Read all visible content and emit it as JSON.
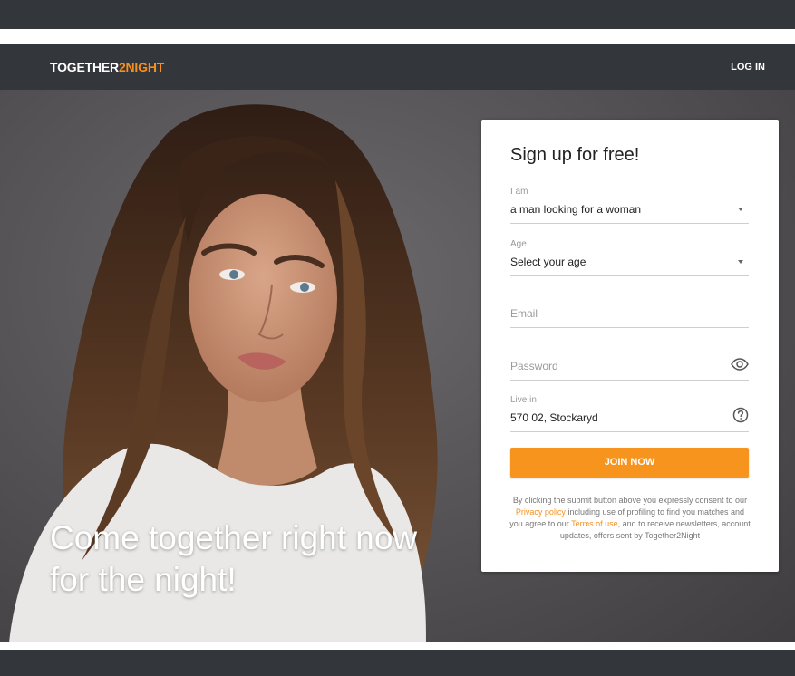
{
  "header": {
    "logo_part1": "TOGETHER",
    "logo_part2": "2NIGHT",
    "login_label": "LOG IN"
  },
  "hero": {
    "headline_line1": "Come together right now",
    "headline_line2": "for the night!"
  },
  "form": {
    "title": "Sign up for free!",
    "iam": {
      "label": "I am",
      "value": "a man looking for a woman"
    },
    "age": {
      "label": "Age",
      "value": "Select your age"
    },
    "email": {
      "placeholder": "Email"
    },
    "password": {
      "placeholder": "Password"
    },
    "location": {
      "label": "Live in",
      "value": "570 02, Stockaryd"
    },
    "submit_label": "JOIN NOW",
    "legal": {
      "text1": "By clicking the submit button above you expressly consent to our ",
      "privacy_link": "Privacy policy",
      "text2": " including use of profiling to find you matches and you agree to our ",
      "terms_link": "Terms of use",
      "text3": ", and to receive newsletters, account updates, offers sent by Together2Night"
    }
  },
  "colors": {
    "accent": "#f7941d",
    "header_bg": "#33363b",
    "card_bg": "#ffffff"
  },
  "icons": {
    "dropdown": "caret-down-icon",
    "password_toggle": "eye-icon",
    "location_help": "question-circle-icon"
  }
}
